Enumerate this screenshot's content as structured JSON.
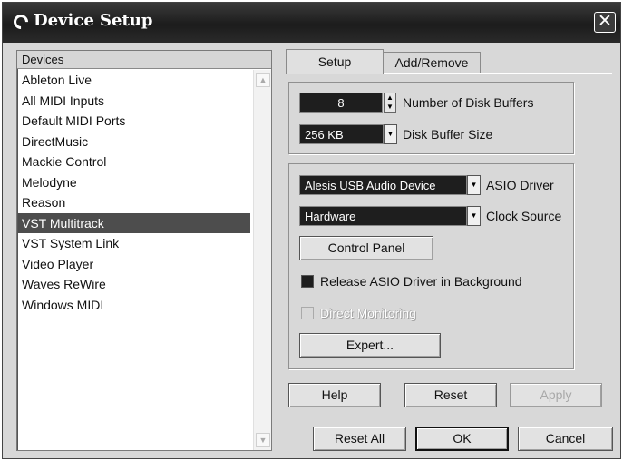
{
  "window": {
    "title": "Device Setup",
    "close_glyph": "✕"
  },
  "devices": {
    "header": "Devices",
    "items": [
      "Ableton Live",
      "All MIDI Inputs",
      "Default MIDI Ports",
      "DirectMusic",
      "Mackie Control",
      "Melodyne",
      "Reason",
      "VST Multitrack",
      "VST System Link",
      "Video Player",
      "Waves ReWire",
      "Windows MIDI"
    ],
    "selected_index": 7
  },
  "tabs": {
    "setup": "Setup",
    "add_remove": "Add/Remove",
    "active": "Setup"
  },
  "disk": {
    "buffers_value": "8",
    "buffers_label": "Number of Disk Buffers",
    "buffer_size_value": "256 KB",
    "buffer_size_label": "Disk Buffer Size"
  },
  "asio": {
    "driver_value": "Alesis USB Audio Device",
    "driver_label": "ASIO Driver",
    "clock_value": "Hardware",
    "clock_label": "Clock Source",
    "control_panel_label": "Control Panel",
    "release_label": "Release ASIO Driver in Background",
    "release_checked": true,
    "direct_monitoring_label": "Direct Monitoring",
    "direct_monitoring_enabled": false,
    "expert_label": "Expert..."
  },
  "buttons": {
    "help": "Help",
    "reset": "Reset",
    "apply": "Apply",
    "reset_all": "Reset All",
    "ok": "OK",
    "cancel": "Cancel"
  },
  "icons": {
    "title": "cubase-logo-icon",
    "close": "close-icon",
    "spin_up": "▲",
    "spin_down": "▼",
    "dropdown": "▼"
  }
}
